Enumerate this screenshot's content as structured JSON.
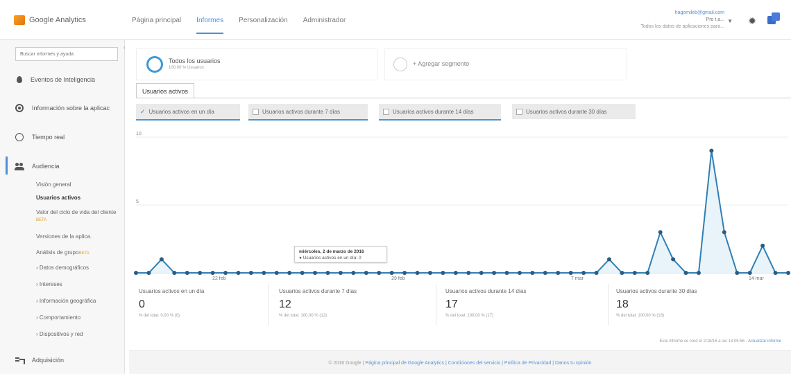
{
  "app": {
    "brand": "Google Analytics"
  },
  "nav": {
    "items": [
      {
        "label": "Página principal",
        "active": false
      },
      {
        "label": "Informes",
        "active": true
      },
      {
        "label": "Personalización",
        "active": false
      },
      {
        "label": "Administrador",
        "active": false
      }
    ]
  },
  "account": {
    "email": "hagomileb@gmail.com",
    "property": "Pro t.a...",
    "view": "Todos los datos de aplicaciones para..."
  },
  "sidebar": {
    "search_placeholder": "Buscar informes y ayuda",
    "items": [
      {
        "label": "Eventos de Inteligencia",
        "icon": "bulb-icon"
      },
      {
        "label": "Información sobre la aplicac",
        "icon": "app-info-icon"
      },
      {
        "label": "Tiempo real",
        "icon": "realtime-icon"
      },
      {
        "label": "Audiencia",
        "icon": "audience-icon"
      },
      {
        "label": "Adquisición",
        "icon": "acquisition-icon"
      }
    ],
    "audience_sub": [
      {
        "label": "Visión general",
        "active": false
      },
      {
        "label": "Usuarios activos",
        "active": true
      },
      {
        "label": "Valor del ciclo de vida del cliente",
        "badge": "BETA",
        "active": false
      },
      {
        "label": "Versiones de la aplica.",
        "active": false
      },
      {
        "label": "Análisis de grupo",
        "badge": "BETA",
        "active": false
      },
      {
        "label": "› Datos demográficos",
        "active": false
      },
      {
        "label": "› Intereses",
        "active": false
      },
      {
        "label": "› Información geográfica",
        "active": false
      },
      {
        "label": "› Comportamiento",
        "active": false
      },
      {
        "label": "› Dispositivos y red",
        "active": false
      }
    ]
  },
  "segments": {
    "active": {
      "title": "Todos los usuarios",
      "subtitle": "100,00 % Usuarios"
    },
    "add_label": "+ Agregar segmento"
  },
  "tab": {
    "label": "Usuarios activos"
  },
  "toggles": [
    {
      "label": "Usuarios activos en un día",
      "checked": true
    },
    {
      "label": "Usuarios activos durante 7 días",
      "checked": false
    },
    {
      "label": "Usuarios activos durante 14 días",
      "checked": false
    },
    {
      "label": "Usuarios activos durante 30 días",
      "checked": false
    }
  ],
  "chart_data": {
    "type": "line",
    "series": [
      {
        "name": "Usuarios activos en un día",
        "color": "#2f7fb4",
        "values": [
          0,
          0,
          1,
          0,
          0,
          0,
          0,
          0,
          0,
          0,
          0,
          0,
          0,
          0,
          0,
          0,
          0,
          0,
          0,
          0,
          0,
          0,
          0,
          0,
          0,
          0,
          0,
          0,
          0,
          0,
          0,
          0,
          0,
          0,
          0,
          0,
          0,
          1,
          0,
          0,
          0,
          3,
          1,
          0,
          0,
          9,
          3,
          0,
          0,
          2,
          0,
          0
        ]
      }
    ],
    "ylim": [
      0,
      10
    ],
    "yticks": [
      "10",
      "5"
    ],
    "xticks": [
      {
        "label": "22 feb",
        "index": 3
      },
      {
        "label": "29 feb",
        "index": 10
      },
      {
        "label": "7 mar",
        "index": 17
      },
      {
        "label": "14 mar",
        "index": 24
      }
    ],
    "grid": true
  },
  "tooltip": {
    "title": "miércoles, 2 de marzo de 2016",
    "value": "● Usuarios activos en un día: 0"
  },
  "metrics": [
    {
      "name": "Usuarios activos en un día",
      "value": "0",
      "pct": "% del total: 0,00 % (0)"
    },
    {
      "name": "Usuarios activos durante 7 días",
      "value": "12",
      "pct": "% del total: 100,00 % (12)"
    },
    {
      "name": "Usuarios activos durante 14 días",
      "value": "17",
      "pct": "% del total: 100,00 % (17)"
    },
    {
      "name": "Usuarios activos durante 30 días",
      "value": "18",
      "pct": "% del total: 100,00 % (18)"
    }
  ],
  "footnote": {
    "text": "Este informe se creó el 2/18/16 a las 13:05:56 - ",
    "link": "Actualizar informe"
  },
  "footer": {
    "copyright": "© 2016 Google | ",
    "links": "Página principal de Google Analytics | Condiciones del servicio | Política de Privacidad | Danos tu opinión"
  }
}
